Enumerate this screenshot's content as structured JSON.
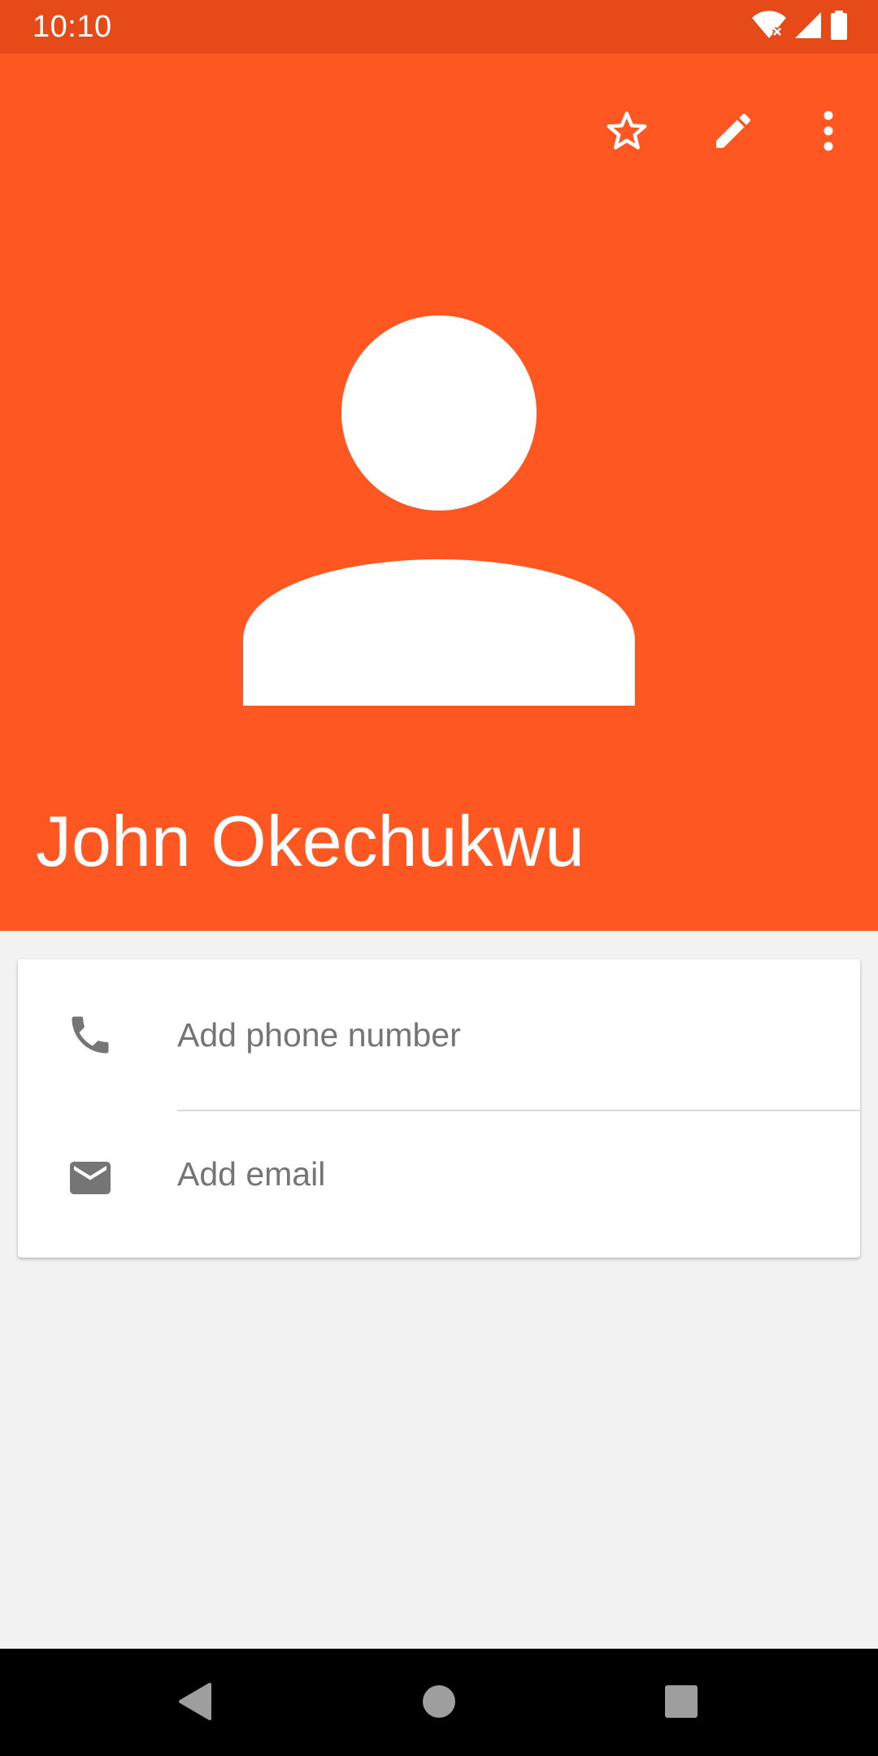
{
  "status_bar": {
    "time": "10:10",
    "icons": [
      "wifi-no-internet-icon",
      "cell-signal-icon",
      "battery-icon"
    ]
  },
  "toolbar": {
    "actions": [
      "star-icon",
      "edit-icon",
      "more-vert-icon"
    ]
  },
  "contact": {
    "name": "John Okechukwu",
    "avatar": "person-placeholder-icon",
    "header_color": "#FF5722",
    "status_bar_color": "#E64A19"
  },
  "details": {
    "phone": {
      "icon": "phone-icon",
      "label": "Add phone number"
    },
    "email": {
      "icon": "email-icon",
      "label": "Add email"
    }
  },
  "nav_bar": {
    "buttons": [
      "back-icon",
      "home-icon",
      "recents-icon"
    ]
  }
}
